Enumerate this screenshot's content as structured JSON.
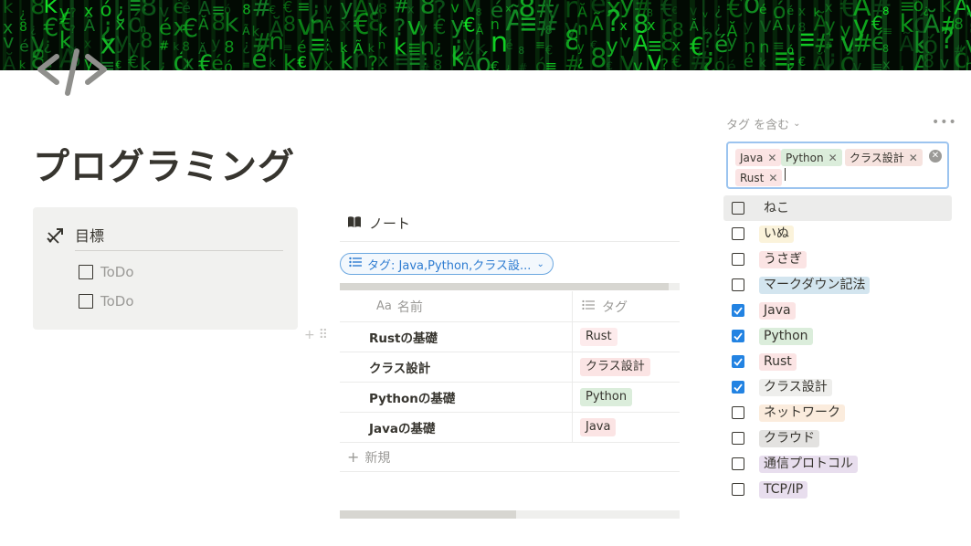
{
  "page": {
    "title": "プログラミング",
    "icon": "code-brackets-icon",
    "cover": "green-matrix-code-cover"
  },
  "callout": {
    "icon": "goal-arrow-icon",
    "heading": "目標",
    "todos": [
      {
        "label": "ToDo",
        "checked": false
      },
      {
        "label": "ToDo",
        "checked": false
      }
    ]
  },
  "database": {
    "title": "ノート",
    "title_icon": "open-book-icon",
    "filter_label": "タグ: Java,Python,クラス設...",
    "columns": {
      "name_icon": "Aa",
      "name": "名前",
      "tags": "タグ"
    },
    "rows": [
      {
        "name": "Rustの基礎",
        "tag": "Rust",
        "tag_color": "#fdebec"
      },
      {
        "name": "クラス設計",
        "tag": "クラス設計",
        "tag_color": "#fbe4e4"
      },
      {
        "name": "Pythonの基礎",
        "tag": "Python",
        "tag_color": "#dbeddb"
      },
      {
        "name": "Javaの基礎",
        "tag": "Java",
        "tag_color": "#fbe4e4"
      }
    ],
    "new_label": "新規"
  },
  "filter_popup": {
    "header": "タグ を含む",
    "selected": [
      {
        "label": "Java",
        "color": "#fbe4e4"
      },
      {
        "label": "Python",
        "color": "#dbeddb"
      },
      {
        "label": "クラス設計",
        "color": "#f6e3df"
      },
      {
        "label": "Rust",
        "color": "#fbe4e4"
      }
    ],
    "options": [
      {
        "label": "ねこ",
        "checked": false,
        "color": "transparent"
      },
      {
        "label": "いぬ",
        "checked": false,
        "color": "#fbf3db"
      },
      {
        "label": "うさぎ",
        "checked": false,
        "color": "#fbe4e4"
      },
      {
        "label": "マークダウン記法",
        "checked": false,
        "color": "#d3e5ef"
      },
      {
        "label": "Java",
        "checked": true,
        "color": "#fbe4e4"
      },
      {
        "label": "Python",
        "checked": true,
        "color": "#dbeddb"
      },
      {
        "label": "Rust",
        "checked": true,
        "color": "#fbe4e4"
      },
      {
        "label": "クラス設計",
        "checked": true,
        "color": "#eeeeec"
      },
      {
        "label": "ネットワーク",
        "checked": false,
        "color": "#fbecdd"
      },
      {
        "label": "クラウド",
        "checked": false,
        "color": "#e3e2e0"
      },
      {
        "label": "通信プロトコル",
        "checked": false,
        "color": "#e8deee"
      },
      {
        "label": "TCP/IP",
        "checked": false,
        "color": "#e8deee"
      }
    ]
  }
}
